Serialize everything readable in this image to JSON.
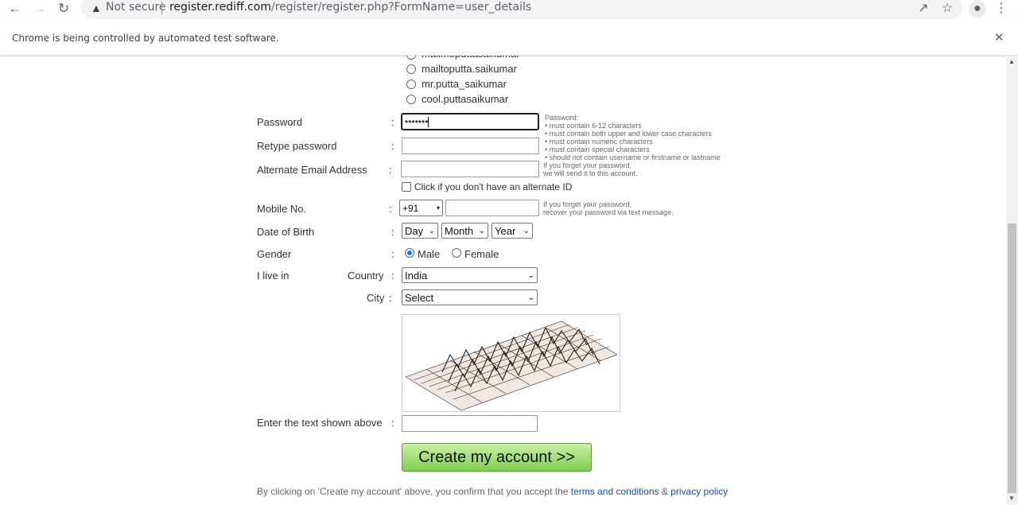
{
  "browser": {
    "url_prefix": "register.rediff.com",
    "url_path": "/register/register.php?FormName=user_details",
    "security_label": "Not secure",
    "infobar_text": "Chrome is being controlled by automated test software."
  },
  "email_suggestions": [
    "mailmeputtasaikumar",
    "mailtoputta.saikumar",
    "mr.putta_saikumar",
    "cool.puttasaikumar"
  ],
  "form": {
    "password_label": "Password",
    "password_value": "•••••••",
    "password_hints": [
      "Password:",
      "• must contain 6-12 characters",
      "• must contain both upper and lower case characters",
      "• must contain numeric characters",
      "• must contain special characters",
      "• should not contain username or firstname or lastname"
    ],
    "retype_label": "Retype password",
    "alt_email_label": "Alternate Email Address",
    "alt_email_hint_1": "If you forget your password,",
    "alt_email_hint_2": "we will send it to this account.",
    "no_alt_id_label": "Click if you don't have an alternate ID",
    "mobile_label": "Mobile No.",
    "mobile_code": "+91",
    "mobile_hint_1": "If you forget your password,",
    "mobile_hint_2": "recover your password via text message.",
    "dob_label": "Date of Birth",
    "dob_day": "Day",
    "dob_month": "Month",
    "dob_year": "Year",
    "gender_label": "Gender",
    "gender_male": "Male",
    "gender_female": "Female",
    "gender_selected": "Male",
    "live_in_label": "I live in",
    "country_label": "Country",
    "country_value": "India",
    "city_label": "City",
    "city_value": "Select",
    "captcha_label": "Enter the text shown above",
    "submit_label": "Create my account >>",
    "footer_prefix": "By clicking on 'Create my account' above, you confirm that you accept the ",
    "footer_terms": "terms and conditions",
    "footer_amp": " & ",
    "footer_privacy": "privacy policy"
  },
  "colon": ":"
}
